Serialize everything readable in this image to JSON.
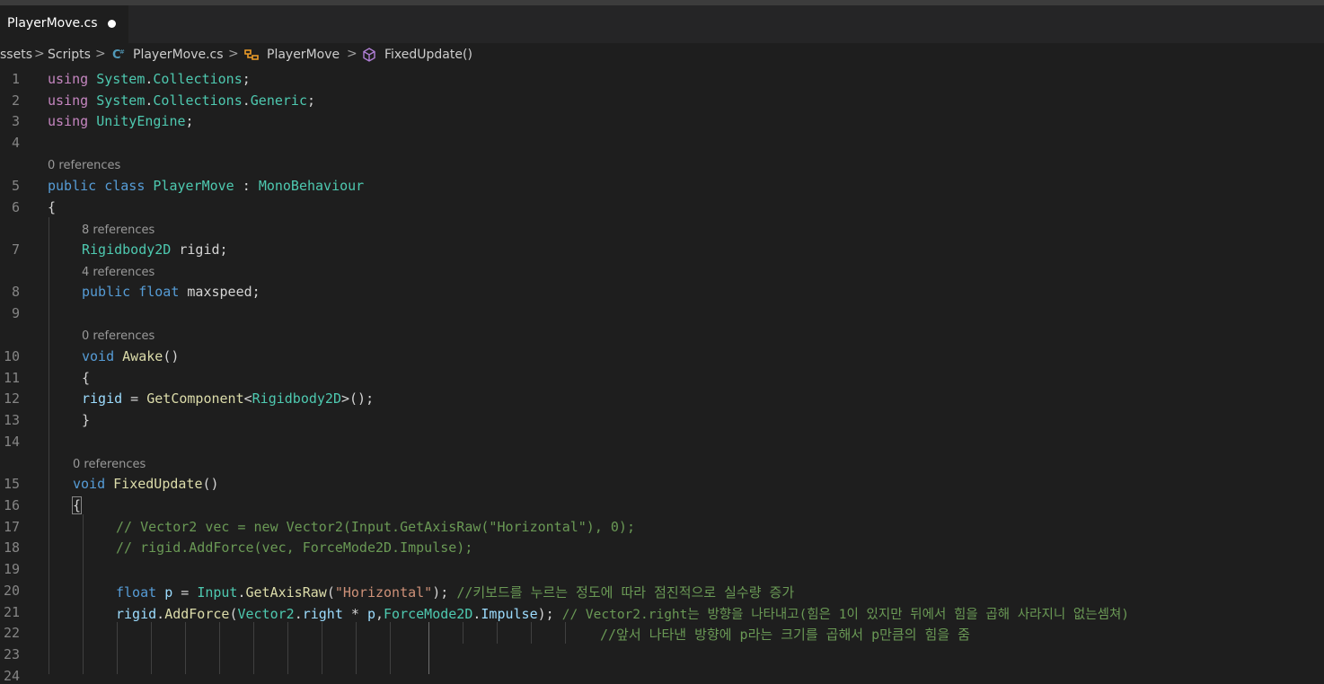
{
  "tab": {
    "title": "PlayerMove.cs",
    "dirty_icon": "dirty-dot-icon"
  },
  "breadcrumb": {
    "segments": [
      "ssets",
      "Scripts",
      "PlayerMove.cs",
      "PlayerMove",
      "FixedUpdate()"
    ],
    "separator": ">"
  },
  "code_lens": {
    "l5": "0 references",
    "l7": "8 references",
    "l8": "4 references",
    "l10": "0 references",
    "l15": "0 references"
  },
  "lines": {
    "n1": "1",
    "n2": "2",
    "n3": "3",
    "n4": "4",
    "n5": "5",
    "n6": "6",
    "n7": "7",
    "n8": "8",
    "n9": "9",
    "n10": "10",
    "n11": "11",
    "n12": "12",
    "n13": "13",
    "n14": "14",
    "n15": "15",
    "n16": "16",
    "n17": "17",
    "n18": "18",
    "n19": "19",
    "n20": "20",
    "n21": "21",
    "n22": "22",
    "n23": "23",
    "n24": "24"
  },
  "code": {
    "l1": {
      "kw": "using",
      "a": "System",
      "dot": ".",
      "b": "Collections",
      "end": ";"
    },
    "l2": {
      "kw": "using",
      "a": "System",
      "dot1": ".",
      "b": "Collections",
      "dot2": ".",
      "c": "Generic",
      "end": ";"
    },
    "l3": {
      "kw": "using",
      "a": "UnityEngine",
      "end": ";"
    },
    "l5": {
      "kw1": "public",
      "kw2": "class",
      "name": "PlayerMove",
      "colon": ":",
      "base": "MonoBehaviour"
    },
    "l6": {
      "brace": "{"
    },
    "l7": {
      "type": "Rigidbody2D",
      "var": "rigid",
      "end": ";"
    },
    "l8": {
      "kw1": "public",
      "kw2": "float",
      "var": "maxspeed",
      "end": ";"
    },
    "l10": {
      "kw": "void",
      "fn": "Awake",
      "paren": "()"
    },
    "l11": {
      "brace": "{"
    },
    "l12": {
      "var": "rigid",
      "eq": " = ",
      "fn": "GetComponent",
      "lt": "<",
      "type": "Rigidbody2D",
      "rest": ">();"
    },
    "l13": {
      "brace": "}"
    },
    "l15": {
      "kw": "void",
      "fn": "FixedUpdate",
      "paren": "()"
    },
    "l16": {
      "brace": "{"
    },
    "l17": {
      "comment": "// Vector2 vec = new Vector2(Input.GetAxisRaw(\"Horizontal\"), 0);"
    },
    "l18": {
      "comment": "// rigid.AddForce(vec, ForceMode2D.Impulse);"
    },
    "l20": {
      "kw": "float",
      "var": "p",
      "eq": " = ",
      "type": "Input",
      "dot": ".",
      "fn": "GetAxisRaw",
      "open": "(",
      "str": "\"Horizontal\"",
      "close": ");",
      "comment": "//키보드를 누르는 정도에 따라 점진적으로 실수량 증가"
    },
    "l21": {
      "var": "rigid",
      "dot1": ".",
      "fn": "AddForce",
      "open": "(",
      "type1": "Vector2",
      "dot2": ".",
      "prop": "right",
      "mul": " * ",
      "p": "p",
      "comma": ",",
      "type2": "ForceMode2D",
      "dot3": ".",
      "enum": "Impulse",
      "close": ");",
      "comment": "// Vector2.right는 방향을 나타내고(힘은 1이 있지만 뒤에서 힘을 곱해 사라지니 없는셈쳐)"
    },
    "l22": {
      "comment": "//앞서 나타낸 방향에 p라는 크기를 곱해서 p만큼의 힘을 줌"
    }
  },
  "colors": {
    "background": "#1e1e1e",
    "keyword": "#569cd6",
    "control_keyword": "#c586c0",
    "type": "#4ec9b0",
    "function": "#dcdcaa",
    "variable": "#9cdcfe",
    "string": "#ce9178",
    "comment": "#6a9955",
    "line_number": "#858585"
  }
}
